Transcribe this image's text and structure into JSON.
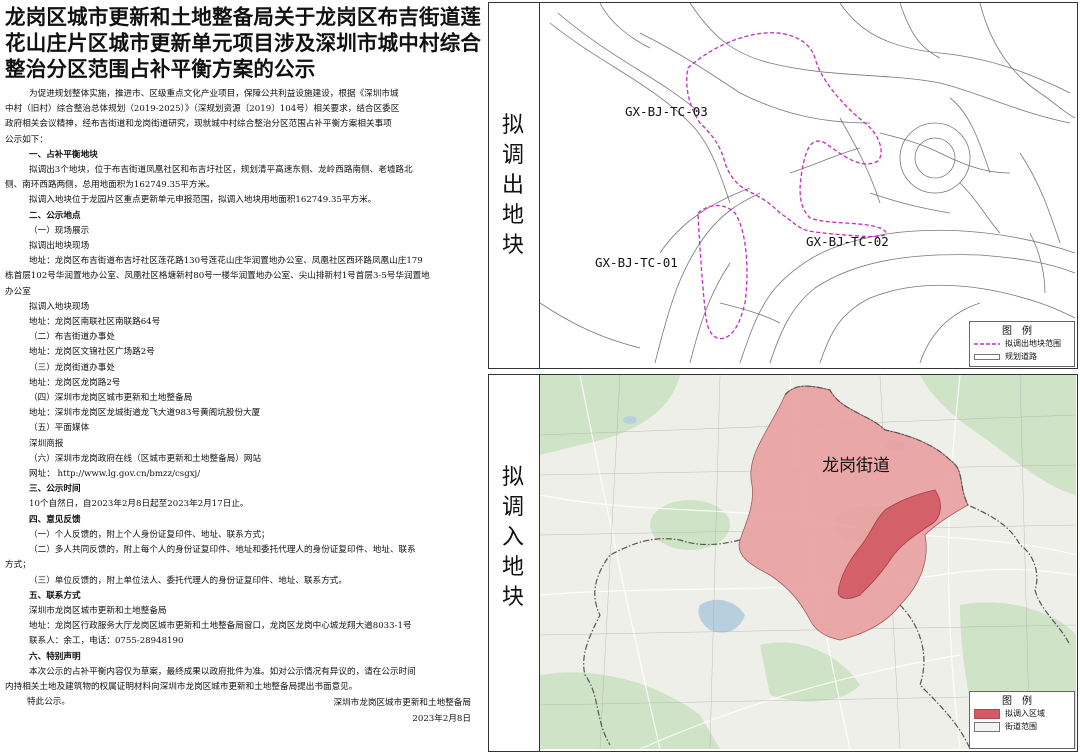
{
  "title_lines": [
    "龙岗区城市更新和土地整备局关于龙岗区布吉街道莲",
    "花山庄片区城市更新单元项目涉及深圳市城中村综合",
    "整治分区范围占补平衡方案的公示"
  ],
  "intro": [
    "为促进规划整体实施，推进市、区级重点文化产业项目，保障公共利益设施建设，根据《深圳市城",
    "中村（旧村）综合整治总体规划（2019-2025）》（深规划资源〔2019〕104号）相关要求，结合区委区",
    "政府相关会议精神，经布吉街道和龙岗街道研究，现就城中村综合整治分区范围占补平衡方案相关事项",
    "公示如下："
  ],
  "s1": {
    "heading": "一、占补平衡地块",
    "p1a": "拟调出3个地块，位于布吉街道凤凰社区和布吉圩社区，规划清平高速东侧、龙岭西路南侧、老墟路北",
    "p1b": "侧、南环西路两侧，总用地面积为162749.35平方米。",
    "p2": "拟调入地块位于龙园片区重点更新单元申报范围，拟调入地块用地面积162749.35平方米。"
  },
  "s2": {
    "heading": "二、公示地点",
    "a": "（一）现场展示",
    "a1": "拟调出地块现场",
    "a2a": "地址：龙岗区布吉街道布吉圩社区莲花路130号莲花山庄华润置地办公室、凤凰社区西环路凤凰山庄179",
    "a2b": "栋首层102号华润置地办公室、凤凰社区格塘新村80号一楼华润置地办公室、尖山排新村1号首层3-5号华润置地",
    "a2c": "办公室",
    "a3": "拟调入地块现场",
    "a4": "地址：龙岗区南联社区南联路64号",
    "b": "（二）布吉街道办事处",
    "b1": "地址：龙岗区文锦社区广场路2号",
    "c": "（三）龙岗街道办事处",
    "c1": "地址：龙岗区龙岗路2号",
    "d": "（四）深圳市龙岗区城市更新和土地整备局",
    "d1": "地址：深圳市龙岗区龙城街道龙飞大道983号黄阁坑股份大厦",
    "e": "（五）平面媒体",
    "e1": "深圳商报",
    "f": "（六）深圳市龙岗政府在线（区城市更新和土地整备局）网站",
    "f1": "网址： http://www.lg.gov.cn/bmzz/csgxj/"
  },
  "s3": {
    "heading": "三、公示时间",
    "p": "10个自然日，自2023年2月8日起至2023年2月17日止。"
  },
  "s4": {
    "heading": "四、意见反馈",
    "a": "（一）个人反馈的，附上个人身份证复印件、地址、联系方式；",
    "b1": "（二）多人共同反馈的，附上每个人的身份证复印件、地址和委托代理人的身份证复印件、地址、联系",
    "b2": "方式；",
    "c": "（三）单位反馈的，附上单位法人、委托代理人的身份证复印件、地址、联系方式。"
  },
  "s5": {
    "heading": "五、联系方式",
    "p1": "深圳市龙岗区城市更新和土地整备局",
    "p2": "地址：龙岗区行政服务大厅龙岗区城市更新和土地整备局窗口，龙岗区龙岗中心城龙翔大道8033-1号",
    "p3": "联系人：余工，电话：0755-28948190"
  },
  "s6": {
    "heading": "六、特别声明",
    "p1": "本次公示的占补平衡内容仅为草案，最终成果以政府批件为准。如对公示情况有异议的，请在公示时间",
    "p2": "内持相关土地及建筑物的权属证明材料向深圳市龙岗区城市更新和土地整备局提出书面意见。",
    "p3": "特此公示。"
  },
  "signature": {
    "org": "深圳市龙岗区城市更新和土地整备局",
    "date": "2023年2月8日"
  },
  "panel_top": {
    "side_label": [
      "拟",
      "调",
      "出",
      "地",
      "块"
    ],
    "parcels": {
      "tc03": "GX-BJ-TC-03",
      "tc02": "GX-BJ-TC-02",
      "tc01": "GX-BJ-TC-01"
    },
    "legend": {
      "title": "图例",
      "items": [
        "拟调出地块范围",
        "规划道路"
      ]
    }
  },
  "panel_bottom": {
    "side_label": [
      "拟",
      "调",
      "入",
      "地",
      "块"
    ],
    "district": "龙岗街道",
    "legend": {
      "title": "图例",
      "items": [
        "拟调入区域",
        "街道范围"
      ]
    }
  },
  "colors": {
    "dashed_boundary": "#c42bbd",
    "district_fill": "#e9a2a2",
    "parcel_fill": "#d25a64",
    "map_bg": "#efefea",
    "green": "#cfe3c6",
    "water": "#b8cfe0"
  }
}
